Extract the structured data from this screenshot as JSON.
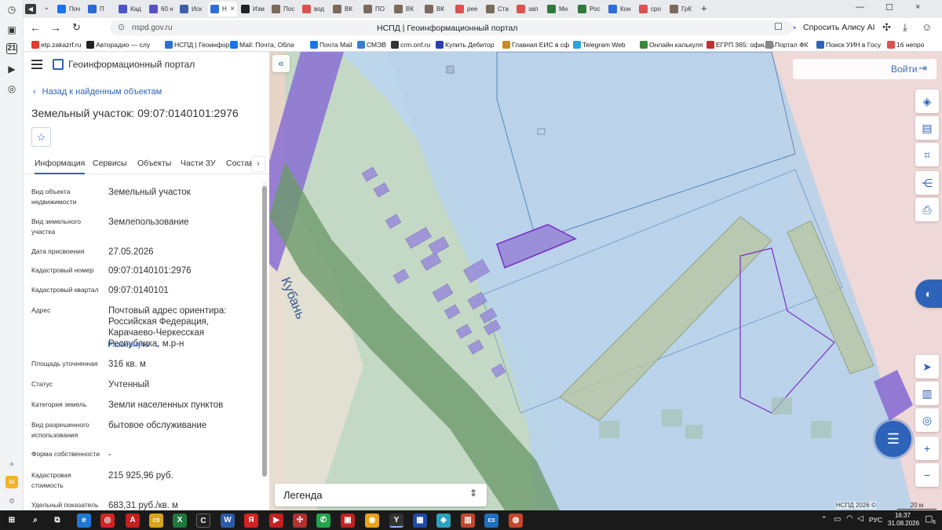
{
  "browser": {
    "tabs": [
      {
        "label": "Поч",
        "fav_color": "#1a73e8"
      },
      {
        "label": "П",
        "fav_color": "#2b6ad3"
      },
      {
        "label": "Кад",
        "fav_color": "#4b56c9"
      },
      {
        "label": "60 н",
        "fav_color": "#5b4fc4"
      },
      {
        "label": "Иск",
        "fav_color": "#3c5fa8"
      },
      {
        "label": "Н",
        "fav_color": "#2d6fd6"
      },
      {
        "label": "Изм",
        "fav_color": "#222222"
      },
      {
        "label": "Пос",
        "fav_color": "#7a6a5c"
      },
      {
        "label": "вод",
        "fav_color": "#d9534f"
      },
      {
        "label": "ВК",
        "fav_color": "#7a6a5c"
      },
      {
        "label": "ПО",
        "fav_color": "#7a6a5c"
      },
      {
        "label": "ВК",
        "fav_color": "#7a6a5c"
      },
      {
        "label": "ВК",
        "fav_color": "#7a6a5c"
      },
      {
        "label": "рее",
        "fav_color": "#d9534f"
      },
      {
        "label": "Ста",
        "fav_color": "#7a6a5c"
      },
      {
        "label": "зап",
        "fav_color": "#d9534f"
      },
      {
        "label": "Ми",
        "fav_color": "#2f7a3a"
      },
      {
        "label": "Рос",
        "fav_color": "#2f7a3a"
      },
      {
        "label": "Кон",
        "fav_color": "#2d6fd6"
      },
      {
        "label": "сро",
        "fav_color": "#d9534f"
      },
      {
        "label": "ГрК",
        "fav_color": "#7a6a5c"
      }
    ],
    "url": "nspd.gov.ru",
    "page_title": "НСПД | Геоинформационный портал",
    "alice_label": "Спросить Алису AI",
    "bookmarks": [
      {
        "label": "etp.zakazrf.ru",
        "color": "#e23b2e"
      },
      {
        "label": "Авторадио — слу",
        "color": "#222222"
      },
      {
        "label": "НСПД | Геоинфор",
        "color": "#2d6fd6"
      },
      {
        "label": "Mail: Почта, Обла",
        "color": "#1a73e8"
      },
      {
        "label": "Почта Mail",
        "color": "#1a73e8"
      },
      {
        "label": "СМЭВ",
        "color": "#3b7fd0"
      },
      {
        "label": "crm.onf.ru",
        "color": "#333333"
      },
      {
        "label": "Купить Дебитор",
        "color": "#2d3fa8"
      },
      {
        "label": "Главная ЕИС в сф",
        "color": "#c58f24"
      },
      {
        "label": "Telegram Web",
        "color": "#2aa3df"
      },
      {
        "label": "Онлайн калькуля",
        "color": "#3a8a3a"
      },
      {
        "label": "ЕГРП 365: официа",
        "color": "#c23030"
      },
      {
        "label": "Портал ФК",
        "color": "#888888"
      },
      {
        "label": "Поиск УИН в Госу",
        "color": "#2d63b8"
      },
      {
        "label": "16 непро",
        "color": "#d9534f"
      }
    ]
  },
  "portal": {
    "title": "Геоинформационный портал",
    "back_link": "Назад к найденным объектам",
    "object_title": "Земельный участок: 09:07:0140101:2976",
    "tabs": [
      "Информация",
      "Сервисы",
      "Объекты",
      "Части ЗУ",
      "Состав"
    ],
    "active_tab": "Информация",
    "expand_link": "Развернуть",
    "fields": [
      {
        "label": "Вид объекта недвижимости",
        "value": "Земельный участок"
      },
      {
        "label": "Вид земельного участка",
        "value": "Землепользование"
      },
      {
        "label": "Дата присвоения",
        "value": "27.05.2026"
      },
      {
        "label": "Кадастровый номер",
        "value": "09:07:0140101:2976"
      },
      {
        "label": "Кадастровый квартал",
        "value": "09:07:0140101"
      },
      {
        "label": "Адрес",
        "value": "Почтовый адрес ориентира: Российская Федерация, Карачаево-Черкесская Республика, м.р-н"
      },
      {
        "label": "Площадь уточненная",
        "value": "316 кв. м"
      },
      {
        "label": "Статус",
        "value": "Учтенный"
      },
      {
        "label": "Категория земель",
        "value": "Земли населенных пунктов"
      },
      {
        "label": "Вид разрешенного использования",
        "value": "бытовое обслуживание"
      },
      {
        "label": "Форма собственности",
        "value": "-"
      },
      {
        "label": "Кадастровая стоимость",
        "value": "215 925,96 руб."
      },
      {
        "label": "Удельный показатель",
        "value": "683,31 руб./кв. м"
      }
    ]
  },
  "map": {
    "login_label": "Войти",
    "river_label": "Кубань",
    "legend_label": "Легенда",
    "copyright": "НСПД 2026 ©",
    "scale_label": "20 м"
  },
  "taskbar": {
    "time": "16:37",
    "date": "31.08.2026",
    "lang": "РУС",
    "notif_count": "6"
  }
}
